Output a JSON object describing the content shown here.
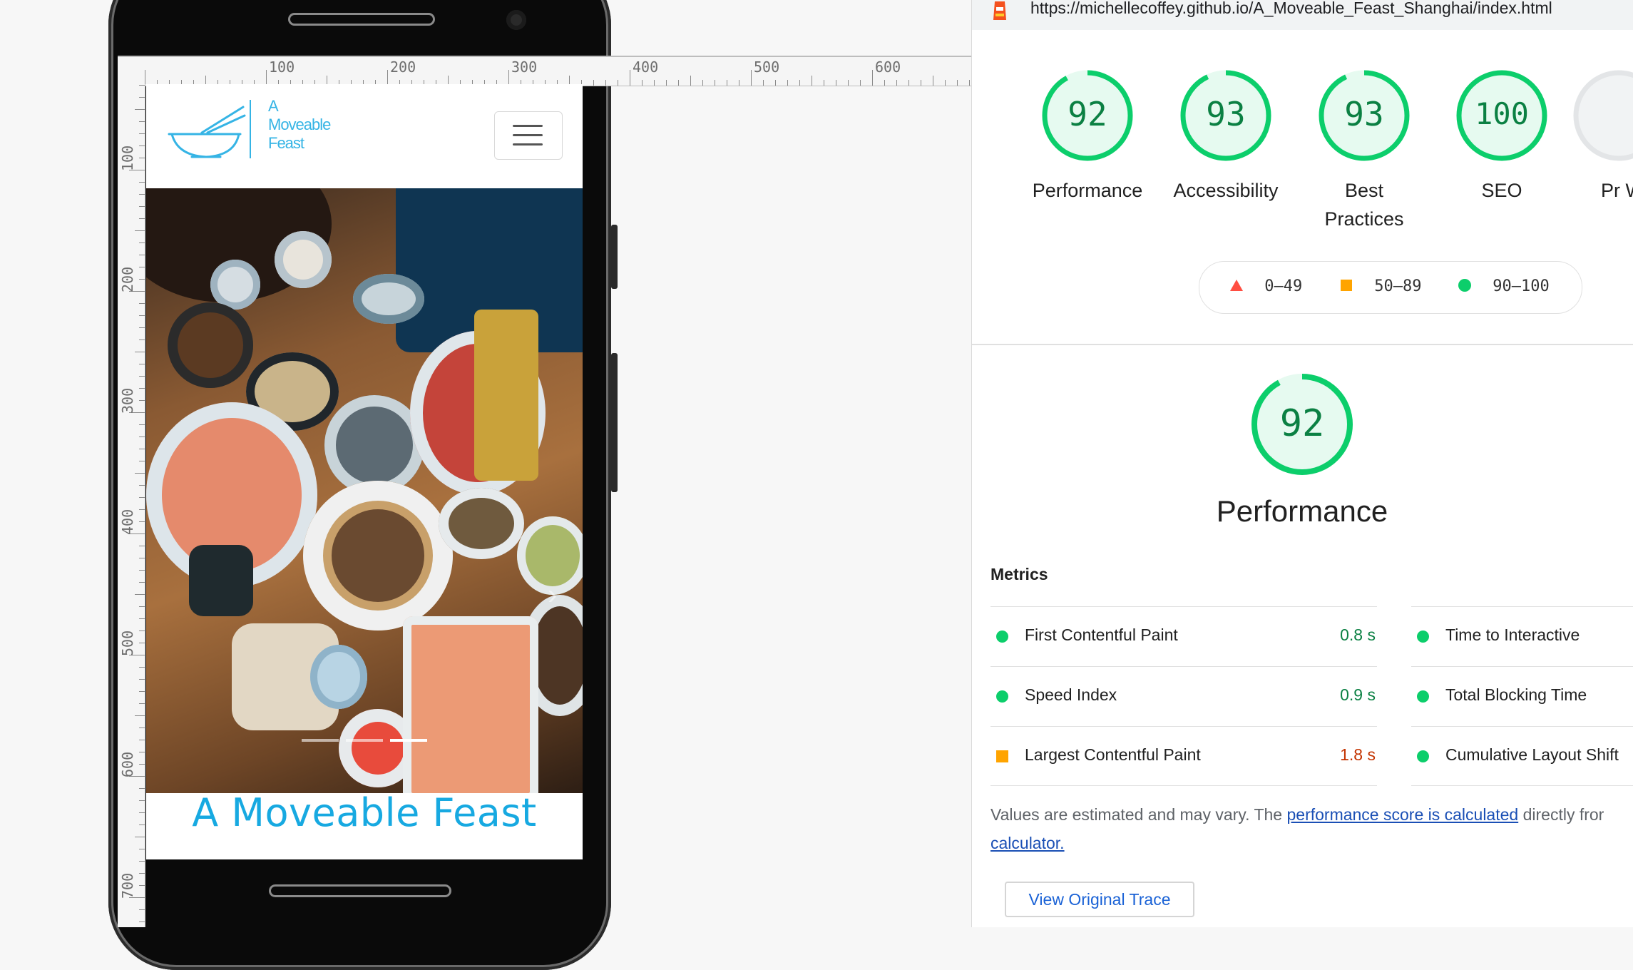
{
  "device": {
    "ruler_top_labels": [
      "100",
      "200",
      "300",
      "400",
      "500",
      "600"
    ],
    "ruler_left_labels": [
      "100",
      "200",
      "300",
      "400",
      "500",
      "600",
      "700"
    ]
  },
  "site": {
    "logo_lines": [
      "A",
      "Moveable",
      "Feast"
    ],
    "hero_title": "A Moveable Feast",
    "carousel_indicators": 3,
    "carousel_active_index": 2
  },
  "lighthouse": {
    "url": "https://michellecoffey.github.io/A_Moveable_Feast_Shanghai/index.html",
    "gauges": [
      {
        "score": "92",
        "label": "Performance"
      },
      {
        "score": "93",
        "label": "Accessibility"
      },
      {
        "score": "93",
        "label": "Best Practices"
      },
      {
        "score": "100",
        "label": "SEO"
      },
      {
        "label": "Pr W"
      }
    ],
    "legend": [
      {
        "range": "0–49",
        "shape": "triangle",
        "color": "#ff4e42"
      },
      {
        "range": "50–89",
        "shape": "square",
        "color": "#ffa400"
      },
      {
        "range": "90–100",
        "shape": "circle",
        "color": "#0cce6b"
      }
    ],
    "main_score": "92",
    "main_label": "Performance",
    "metrics_title": "Metrics",
    "metrics_left": [
      {
        "label": "First Contentful Paint",
        "value": "0.8 s",
        "status": "pass"
      },
      {
        "label": "Speed Index",
        "value": "0.9 s",
        "status": "pass"
      },
      {
        "label": "Largest Contentful Paint",
        "value": "1.8 s",
        "status": "average"
      }
    ],
    "metrics_right": [
      {
        "label": "Time to Interactive",
        "status": "pass"
      },
      {
        "label": "Total Blocking Time",
        "status": "pass"
      },
      {
        "label": "Cumulative Layout Shift",
        "status": "pass"
      }
    ],
    "note_prefix": "Values are estimated and may vary. The ",
    "note_link1": "performance score is calculated",
    "note_middle": " directly fror",
    "note_link2": "calculator.",
    "trace_button": "View Original Trace",
    "colors": {
      "pass": "#0cce6b",
      "pass_text": "#0b8043",
      "average": "#ffa400",
      "average_text": "#c33300",
      "fail": "#ff4e42"
    }
  }
}
